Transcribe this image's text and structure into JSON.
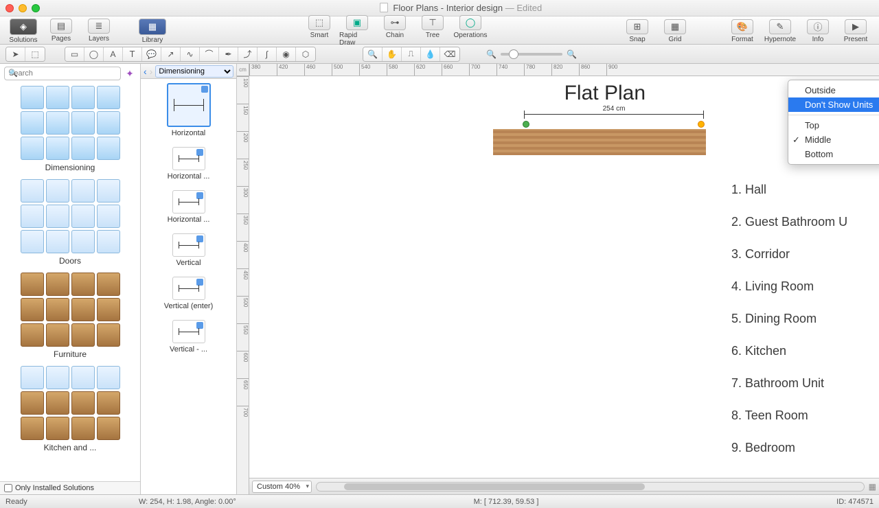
{
  "window": {
    "title": "Floor Plans - Interior design",
    "edited": "— Edited"
  },
  "toolbar": {
    "solutions": "Solutions",
    "pages": "Pages",
    "layers": "Layers",
    "library": "Library",
    "smart": "Smart",
    "rapid": "Rapid Draw",
    "chain": "Chain",
    "tree": "Tree",
    "operations": "Operations",
    "snap": "Snap",
    "grid": "Grid",
    "format": "Format",
    "hypernote": "Hypernote",
    "info": "Info",
    "present": "Present"
  },
  "search": {
    "placeholder": "Search"
  },
  "libs": {
    "dimensioning": "Dimensioning",
    "doors": "Doors",
    "furniture": "Furniture",
    "kitchen": "Kitchen and ..."
  },
  "only_installed": "Only Installed Solutions",
  "shape_panel": {
    "back": "‹",
    "fwd": "›",
    "category": "Dimensioning",
    "items": [
      "Horizontal",
      "Horizontal ...",
      "Horizontal  ...",
      "Vertical",
      "Vertical (enter)",
      "Vertical - ..."
    ]
  },
  "ruler_unit": "cm",
  "canvas": {
    "title": "Flat Plan",
    "dim_label": "254 cm",
    "legend": [
      {
        "n": "1",
        "t": "Hall"
      },
      {
        "n": "2",
        "t": "Guest Bathroom U"
      },
      {
        "n": "3",
        "t": "Corridor"
      },
      {
        "n": "4",
        "t": "Living Room"
      },
      {
        "n": "5",
        "t": "Dining Room"
      },
      {
        "n": "6",
        "t": "Kitchen"
      },
      {
        "n": "7",
        "t": "Bathroom Unit"
      },
      {
        "n": "8",
        "t": "Teen Room"
      },
      {
        "n": "9",
        "t": "Bedroom"
      }
    ],
    "rooms": {
      "1": "1",
      "2": "2",
      "3": "3",
      "4": "4",
      "5": "5",
      "6": "6",
      "7": "7",
      "8": "8",
      "9": "9"
    }
  },
  "ctx": {
    "outside": "Outside",
    "dont_show": "Don't Show Units",
    "top": "Top",
    "middle": "Middle",
    "bottom": "Bottom"
  },
  "zoom": "Custom 40%",
  "status": {
    "ready": "Ready",
    "dims": "W: 254,  H: 1.98,  Angle: 0.00°",
    "mouse": "M: [ 712.39, 59.53 ]",
    "id": "ID: 474571"
  }
}
